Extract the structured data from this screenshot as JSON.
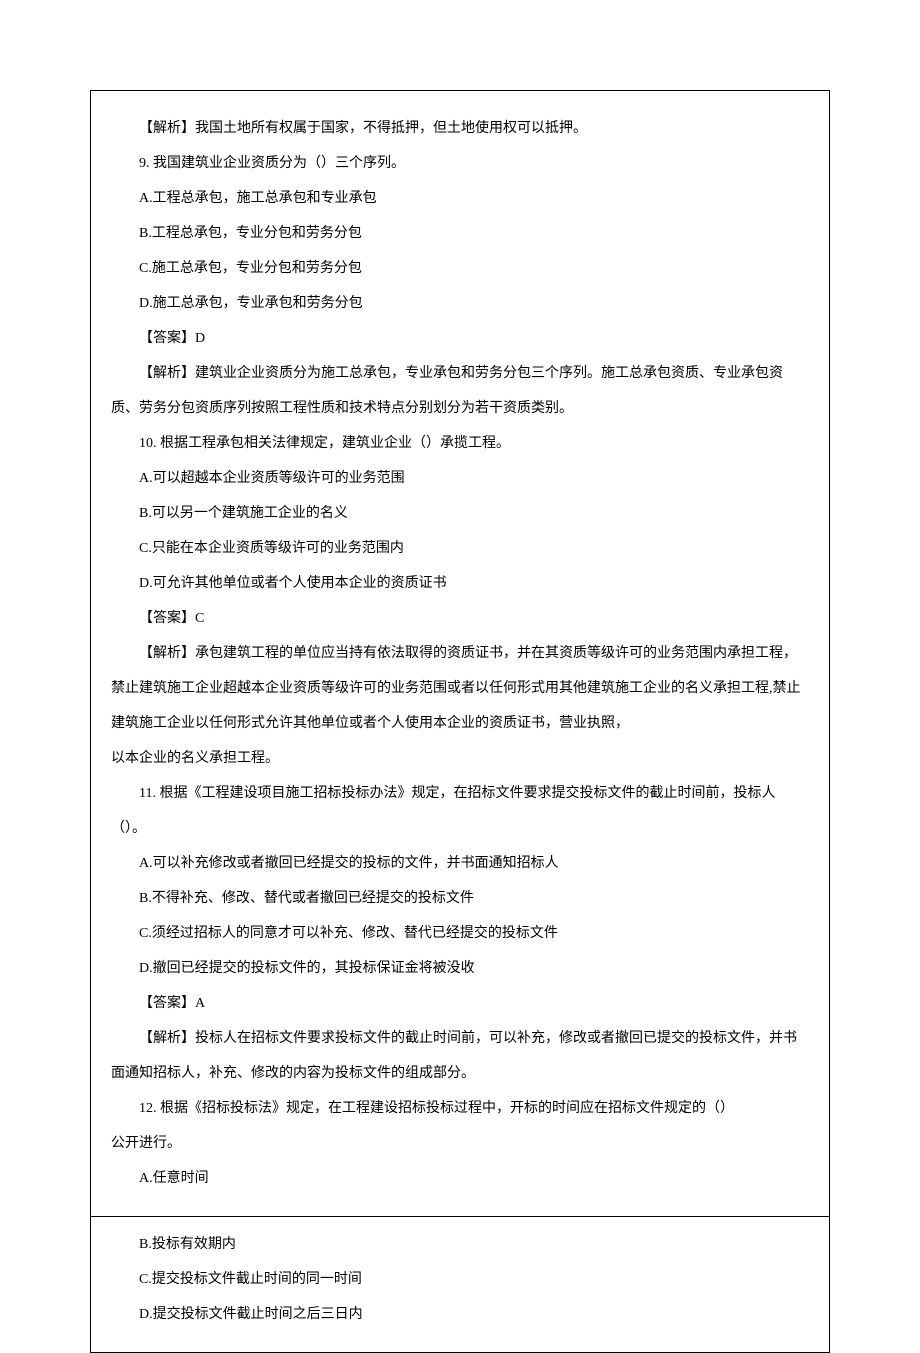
{
  "block1": {
    "analysis8": "【解析】我国土地所有权属于国家，不得抵押，但土地使用权可以抵押。",
    "q9": {
      "stem": "9. 我国建筑业企业资质分为（）三个序列。",
      "a": "A.工程总承包，施工总承包和专业承包",
      "b": "B.工程总承包，专业分包和劳务分包",
      "c": "C.施工总承包，专业分包和劳务分包",
      "d": "D.施工总承包，专业承包和劳务分包",
      "answer": "【答案】D",
      "analysis": "【解析】建筑业企业资质分为施工总承包，专业承包和劳务分包三个序列。施工总承包资质、专业承包资质、劳务分包资质序列按照工程性质和技术特点分别划分为若干资质类别。"
    },
    "q10": {
      "stem": "10. 根据工程承包相关法律规定，建筑业企业（）承揽工程。",
      "a": "A.可以超越本企业资质等级许可的业务范围",
      "b": "B.可以另一个建筑施工企业的名义",
      "c": "C.只能在本企业资质等级许可的业务范围内",
      "d": "D.可允许其他单位或者个人使用本企业的资质证书",
      "answer": "【答案】C",
      "analysis_p1": "【解析】承包建筑工程的单位应当持有依法取得的资质证书，并在其资质等级许可的业务范围内承担工程，禁止建筑施工企业超越本企业资质等级许可的业务范围或者以任何形式用其他建筑施工企业的名义承担工程,禁止建筑施工企业以任何形式允许其他单位或者个人使用本企业的资质证书，营业执照，",
      "analysis_p2": "以本企业的名义承担工程。"
    },
    "q11": {
      "stem": "11. 根据《工程建设项目施工招标投标办法》规定，在招标文件要求提交投标文件的截止时间前，投标人（）。",
      "a": "A.可以补充修改或者撤回已经提交的投标的文件，并书面通知招标人",
      "b": "B.不得补充、修改、替代或者撤回已经提交的投标文件",
      "c": "C.须经过招标人的同意才可以补充、修改、替代已经提交的投标文件",
      "d": "D.撤回已经提交的投标文件的，其投标保证金将被没收",
      "answer": "【答案】A",
      "analysis": "【解析】投标人在招标文件要求投标文件的截止时间前，可以补充，修改或者撤回已提交的投标文件，并书面通知招标人，补充、修改的内容为投标文件的组成部分。"
    },
    "q12": {
      "stem_p1": "12. 根据《招标投标法》规定，在工程建设招标投标过程中，开标的时间应在招标文件规定的（）",
      "stem_p2": "公开进行。",
      "a": "A.任意时间"
    }
  },
  "block2": {
    "q12": {
      "b": "B.投标有效期内",
      "c": "C.提交投标文件截止时间的同一时间",
      "d": "D.提交投标文件截止时间之后三日内"
    }
  }
}
